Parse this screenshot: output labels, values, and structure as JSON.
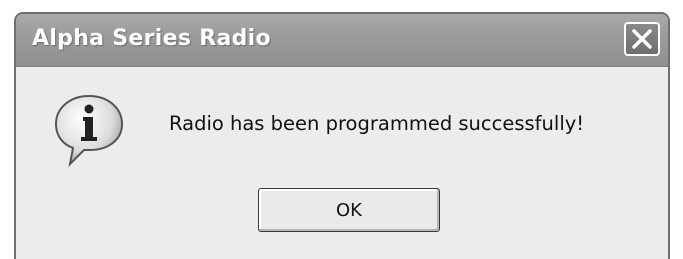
{
  "window": {
    "title": "Alpha Series Radio"
  },
  "icons": {
    "close": "close-icon",
    "info": "information-icon"
  },
  "message": {
    "text": "Radio has been programmed successfully!"
  },
  "buttons": {
    "ok_label": "OK"
  }
}
